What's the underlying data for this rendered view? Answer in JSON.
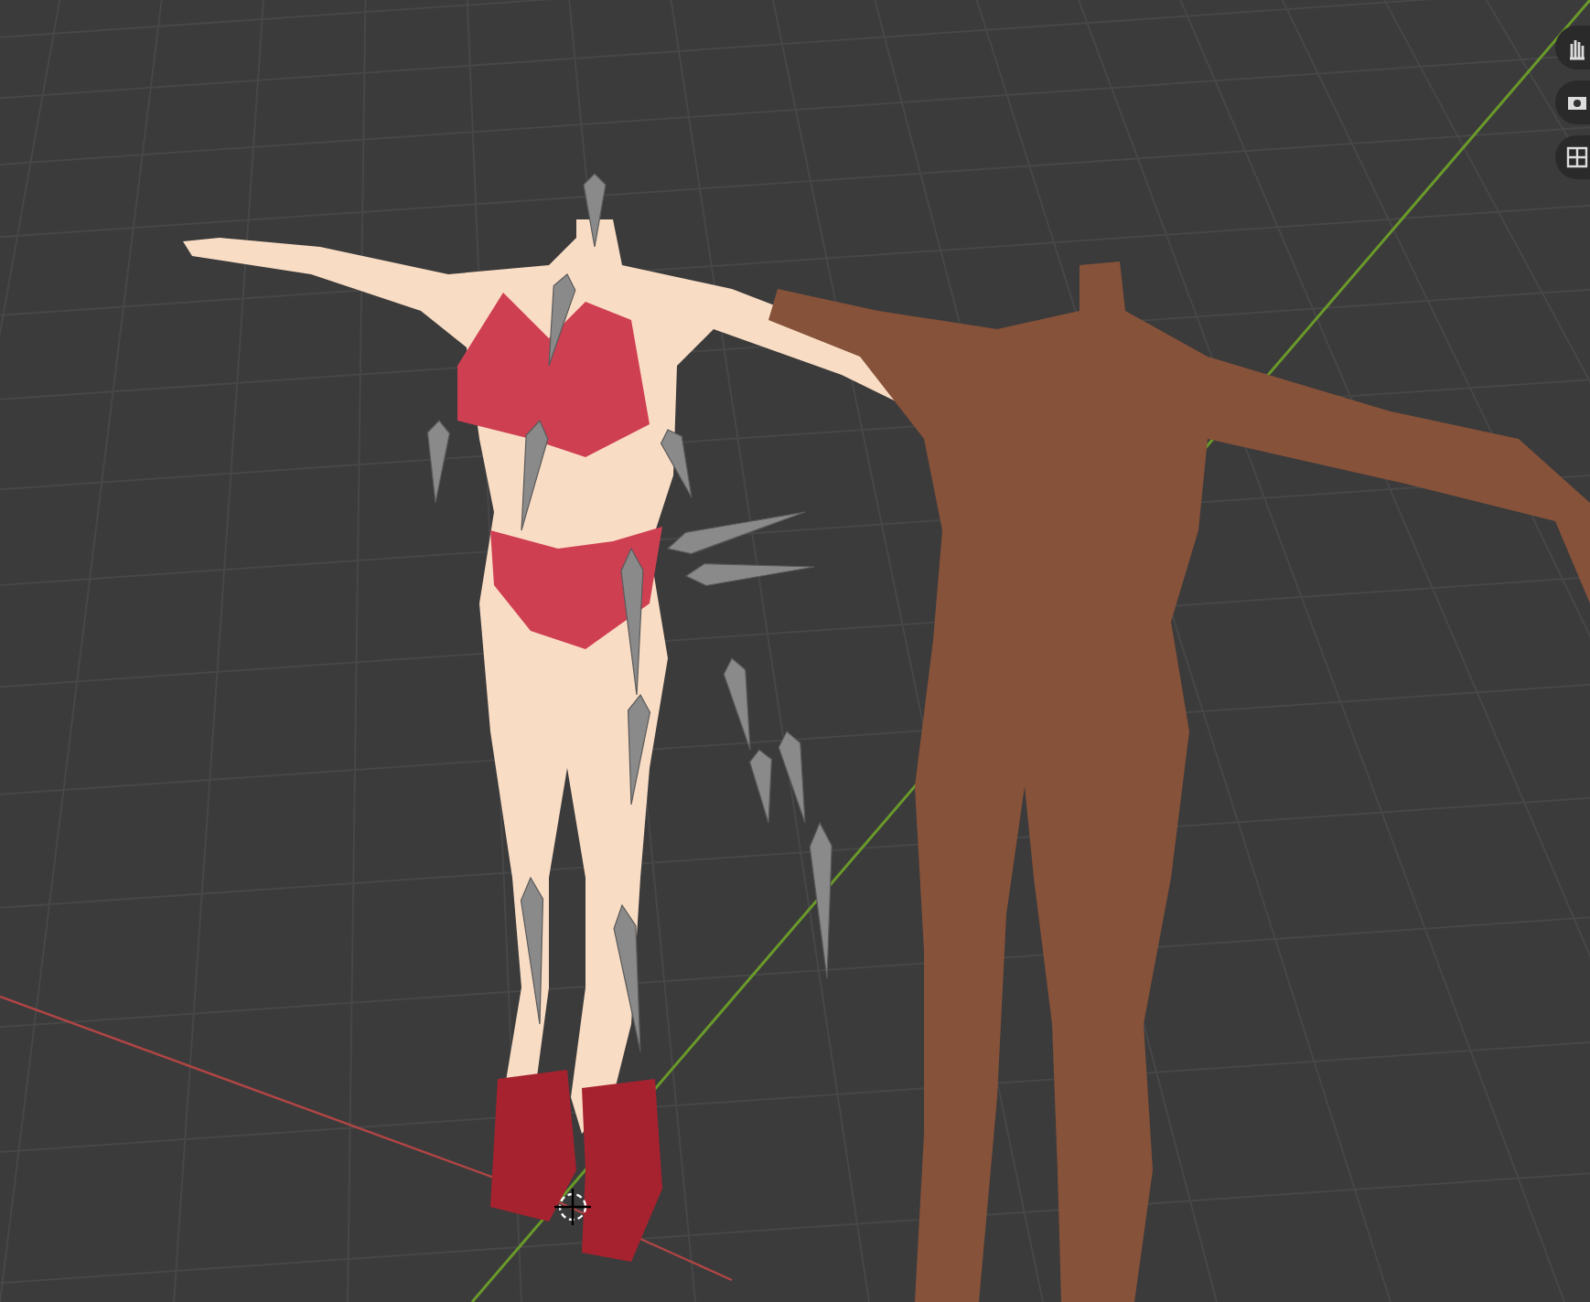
{
  "viewport": {
    "figures": [
      {
        "kind": "rigged",
        "color": "#f9dcc4"
      },
      {
        "kind": "silhouette",
        "color": "#87523a"
      }
    ]
  }
}
